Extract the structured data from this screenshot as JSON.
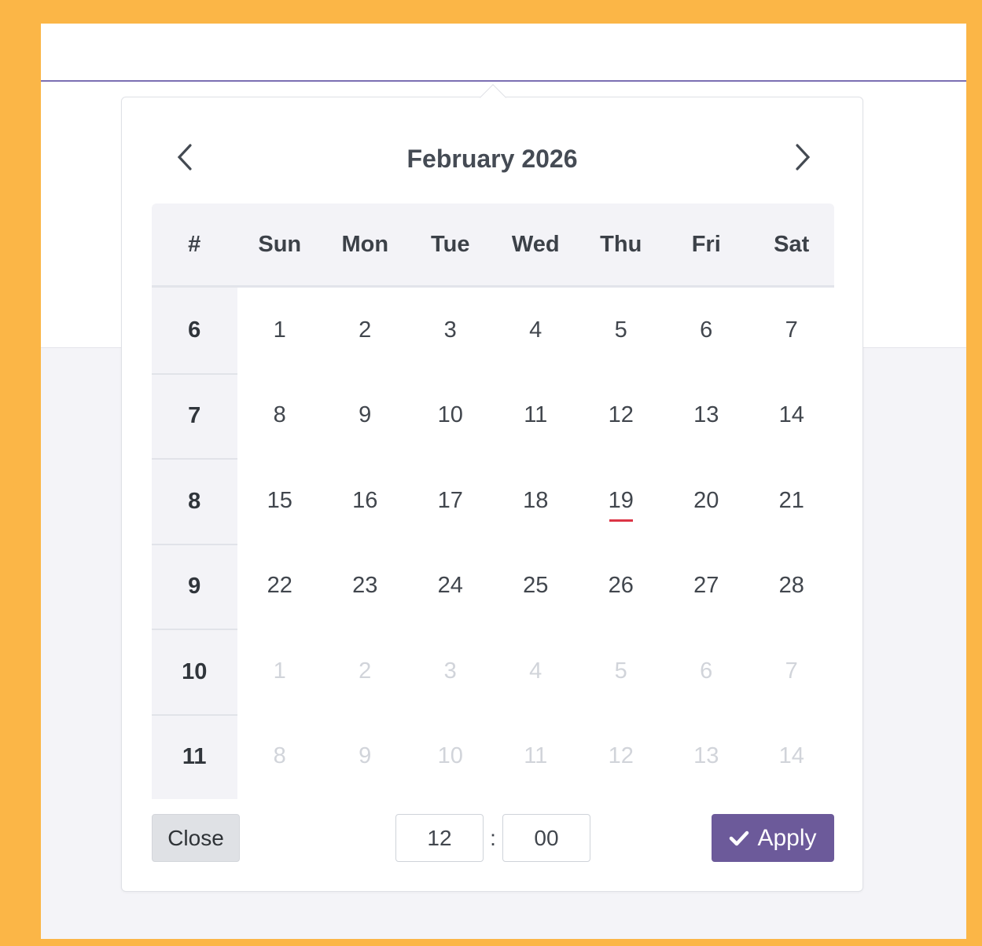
{
  "header": {
    "month_title": "February 2026",
    "prev_icon": "chevron-left-icon",
    "next_icon": "chevron-right-icon"
  },
  "weekday_header": [
    "#",
    "Sun",
    "Mon",
    "Tue",
    "Wed",
    "Thu",
    "Fri",
    "Sat"
  ],
  "weeks": [
    {
      "number": "6",
      "days": [
        {
          "d": "1"
        },
        {
          "d": "2"
        },
        {
          "d": "3"
        },
        {
          "d": "4"
        },
        {
          "d": "5"
        },
        {
          "d": "6"
        },
        {
          "d": "7"
        }
      ]
    },
    {
      "number": "7",
      "days": [
        {
          "d": "8"
        },
        {
          "d": "9"
        },
        {
          "d": "10"
        },
        {
          "d": "11"
        },
        {
          "d": "12"
        },
        {
          "d": "13"
        },
        {
          "d": "14"
        }
      ]
    },
    {
      "number": "8",
      "days": [
        {
          "d": "15"
        },
        {
          "d": "16"
        },
        {
          "d": "17"
        },
        {
          "d": "18"
        },
        {
          "d": "19",
          "today": true
        },
        {
          "d": "20"
        },
        {
          "d": "21"
        }
      ]
    },
    {
      "number": "9",
      "days": [
        {
          "d": "22"
        },
        {
          "d": "23"
        },
        {
          "d": "24"
        },
        {
          "d": "25"
        },
        {
          "d": "26"
        },
        {
          "d": "27"
        },
        {
          "d": "28"
        }
      ]
    },
    {
      "number": "10",
      "days": [
        {
          "d": "1",
          "muted": true
        },
        {
          "d": "2",
          "muted": true
        },
        {
          "d": "3",
          "muted": true
        },
        {
          "d": "4",
          "muted": true
        },
        {
          "d": "5",
          "muted": true
        },
        {
          "d": "6",
          "muted": true
        },
        {
          "d": "7",
          "muted": true
        }
      ]
    },
    {
      "number": "11",
      "days": [
        {
          "d": "8",
          "muted": true
        },
        {
          "d": "9",
          "muted": true
        },
        {
          "d": "10",
          "muted": true
        },
        {
          "d": "11",
          "muted": true
        },
        {
          "d": "12",
          "muted": true
        },
        {
          "d": "13",
          "muted": true
        },
        {
          "d": "14",
          "muted": true
        }
      ]
    }
  ],
  "footer": {
    "close_label": "Close",
    "hour_value": "12",
    "time_separator": ":",
    "minute_value": "00",
    "apply_label": "Apply",
    "apply_icon": "check-icon"
  },
  "colors": {
    "frame": "#fbb647",
    "accent": "#6c5a9a",
    "today_marker": "#dc3545",
    "underline": "#7b6fb3"
  }
}
